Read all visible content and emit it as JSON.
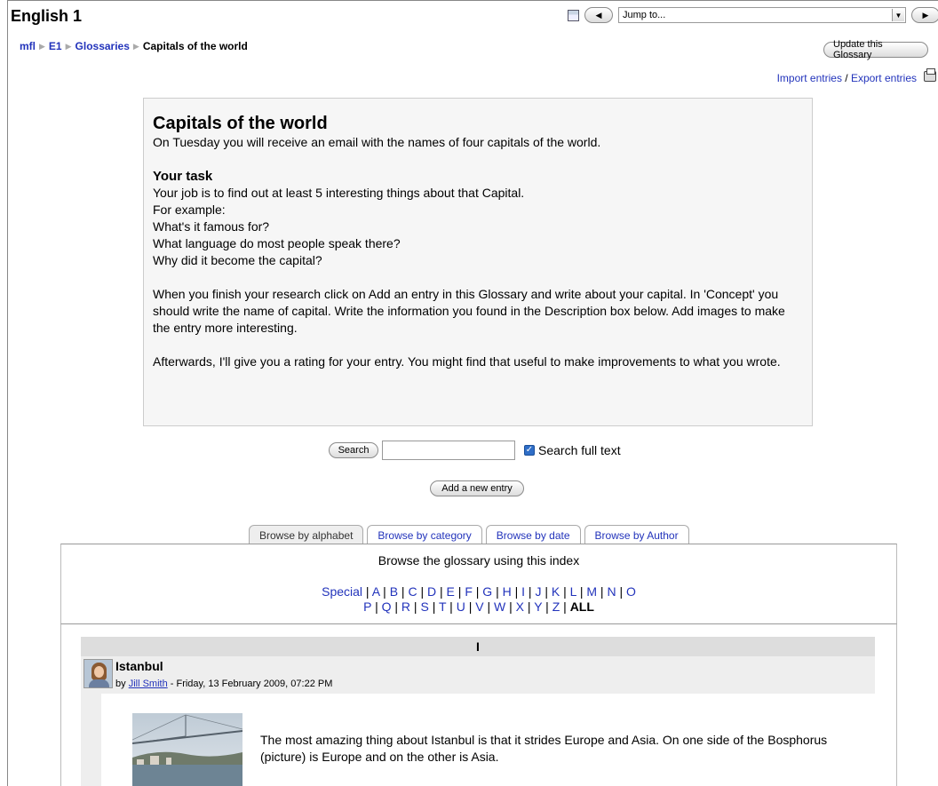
{
  "header": {
    "course_title": "English 1",
    "jump_placeholder": "Jump to...",
    "prev_arrow": "◀",
    "next_arrow": "▶"
  },
  "breadcrumb": {
    "items": [
      "mfl",
      "E1",
      "Glossaries"
    ],
    "separator": "▶",
    "current": "Capitals of the world"
  },
  "toolbar": {
    "update_label": "Update this Glossary",
    "import_label": "Import entries",
    "slash": " / ",
    "export_label": "Export entries"
  },
  "intro": {
    "title": "Capitals of the world",
    "lead": "On Tuesday you will receive an email with the names of four capitals of the world.",
    "task_heading": "Your task",
    "task_lines": [
      "Your job is to find out at least 5 interesting things about that Capital.",
      "For example:",
      "What's it famous for?",
      "What language do most people speak there?",
      "Why did it become the capital?"
    ],
    "para2": "When you finish your research click on Add an entry in this Glossary and write about your capital. In 'Concept' you should write the name of capital. Write the information you found in the Description box below. Add images to make the entry more interesting.",
    "para3": "Afterwards, I'll give you a rating for your entry. You might find that useful to make improvements to what you wrote."
  },
  "search": {
    "button_label": "Search",
    "value": "",
    "fulltext_label": "Search full text",
    "fulltext_checked": true
  },
  "add_entry_label": "Add a new entry",
  "tabs": [
    {
      "label": "Browse by alphabet",
      "selected": true
    },
    {
      "label": "Browse by category",
      "selected": false
    },
    {
      "label": "Browse by date",
      "selected": false
    },
    {
      "label": "Browse by Author",
      "selected": false
    }
  ],
  "browse": {
    "hint": "Browse the glossary using this index",
    "row1": [
      "Special",
      "A",
      "B",
      "C",
      "D",
      "E",
      "F",
      "G",
      "H",
      "I",
      "J",
      "K",
      "L",
      "M",
      "N",
      "O"
    ],
    "row2": [
      "P",
      "Q",
      "R",
      "S",
      "T",
      "U",
      "V",
      "W",
      "X",
      "Y",
      "Z"
    ],
    "current": "ALL",
    "separator": " | "
  },
  "section_letter": "I",
  "entry": {
    "concept": "Istanbul",
    "by": "by ",
    "author": "Jill Smith",
    "date": " - Friday, 13 February 2009, 07:22 PM",
    "text": "The most amazing thing about Istanbul is that it strides Europe and Asia. On one side of the Bosphorus (picture) is Europe and on the other is Asia."
  },
  "colors": {
    "link": "#2233bb",
    "tab_selected_bg": "#eeeeee",
    "letter_bar_bg": "#dddddd",
    "intro_bg": "#f6f6f6"
  },
  "icons": [
    "save-icon",
    "prev-arrow-icon",
    "next-arrow-icon",
    "dropdown-arrow-icon",
    "print-icon",
    "checkbox-checked-icon"
  ]
}
